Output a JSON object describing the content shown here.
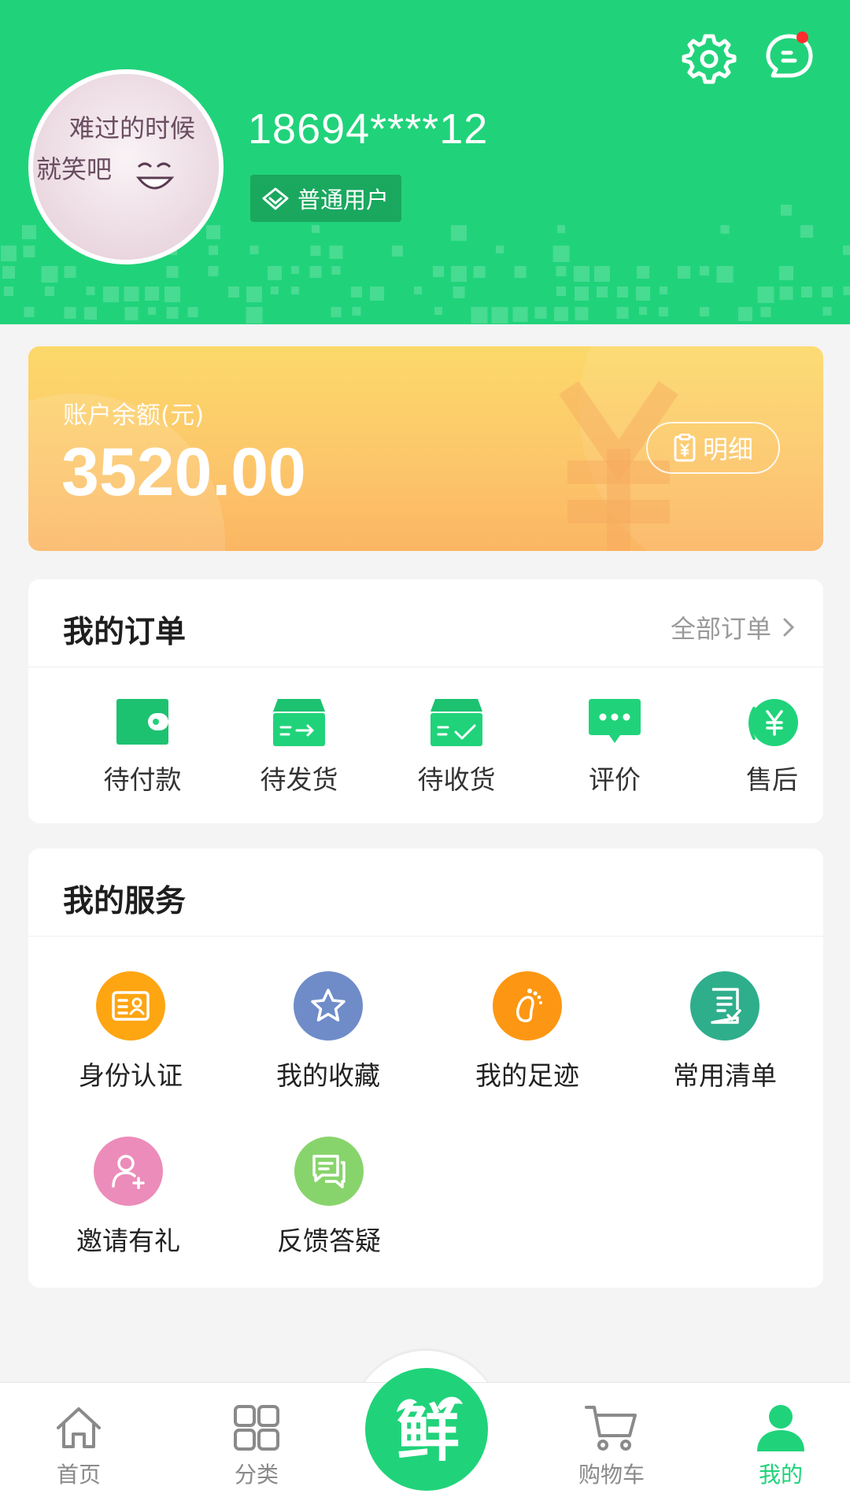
{
  "colors": {
    "brand_green": "#20d37a",
    "badge_green": "#1aa85f",
    "balance_gradient": [
      "#fcd96a",
      "#fbb663"
    ],
    "notification_dot": "#ff2d2d"
  },
  "header": {
    "settings_icon": "gear-icon",
    "messages_icon": "chat-bubble-icon",
    "has_unread_messages": true,
    "avatar_text_line1": "难过的时候",
    "avatar_text_line2": "就笑吧",
    "phone": "18694****12",
    "membership_level": "普通用户"
  },
  "balance": {
    "label": "账户余额(元)",
    "amount": "3520.00",
    "detail_label": "明细"
  },
  "orders": {
    "title": "我的订单",
    "all_label": "全部订单",
    "items": [
      {
        "label": "待付款",
        "icon": "wallet-icon"
      },
      {
        "label": "待发货",
        "icon": "shipping-box-icon"
      },
      {
        "label": "待收货",
        "icon": "delivery-check-icon"
      },
      {
        "label": "评价",
        "icon": "comment-dots-icon"
      },
      {
        "label": "售后",
        "icon": "yuan-refund-icon"
      }
    ]
  },
  "services": {
    "title": "我的服务",
    "items": [
      {
        "label": "身份认证",
        "icon": "id-card-icon",
        "color": "#fea512"
      },
      {
        "label": "我的收藏",
        "icon": "star-icon",
        "color": "#6f8cc9"
      },
      {
        "label": "我的足迹",
        "icon": "footprint-icon",
        "color": "#fd9713"
      },
      {
        "label": "常用清单",
        "icon": "checklist-icon",
        "color": "#2fae8c"
      },
      {
        "label": "邀请有礼",
        "icon": "add-user-icon",
        "color": "#ec8cba"
      },
      {
        "label": "反馈答疑",
        "icon": "feedback-icon",
        "color": "#88d46c"
      }
    ]
  },
  "bottom_nav": {
    "items": [
      {
        "label": "首页",
        "icon": "home-icon"
      },
      {
        "label": "分类",
        "icon": "grid-icon"
      },
      {
        "label": "购物车",
        "icon": "cart-icon"
      },
      {
        "label": "我的",
        "icon": "user-icon",
        "active": true
      }
    ],
    "center_logo_text": "鲜"
  }
}
